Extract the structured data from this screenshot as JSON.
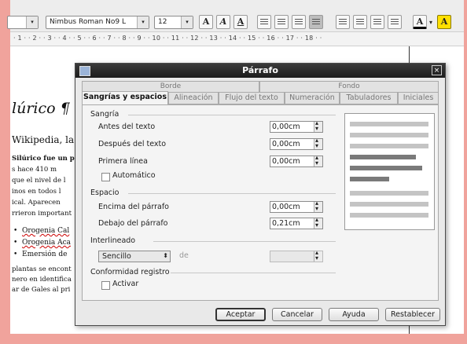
{
  "toolbar": {
    "font_name": "Nimbus Roman No9 L",
    "font_size": "12",
    "bold": "A",
    "italic": "A",
    "underline": "A",
    "font_color": "A",
    "highlight": "A"
  },
  "ruler": {
    "marks": "· 1 · · 2 · · 3 · · 4 · · 5 · · 6 · · 7 · · 8 · · 9 · · 10 · · 11 · · 12 · · 13 · · 14 · · 15 · · 16 · · 17 · · 18 · ·"
  },
  "document": {
    "heading": "lúrico ¶",
    "line1": "Wikipedia, la",
    "para_lines": [
      "Silúrico fue un pe",
      "s hace 410 m",
      "que el nivel de l",
      "inos en todos l",
      "ical. Aparecen",
      "rrieron important"
    ],
    "bullets": [
      "Orogenia Cal",
      "Orogenia Aca",
      "Emersión de"
    ],
    "tail_lines": [
      "plantas se encont",
      "nero en identifica",
      "ar de Gales al pri"
    ]
  },
  "dialog": {
    "title": "Párrafo",
    "close_glyph": "×",
    "tabs_row1": [
      "Borde",
      "Fondo"
    ],
    "tabs_row2": [
      "Sangrías y espacios",
      "Alineación",
      "Flujo del texto",
      "Numeración",
      "Tabuladores",
      "Iniciales"
    ],
    "sangria": {
      "title": "Sangría",
      "antes_label": "Antes del texto",
      "antes_value": "0,00cm",
      "despues_label": "Después del texto",
      "despues_value": "0,00cm",
      "primera_label": "Primera línea",
      "primera_value": "0,00cm",
      "auto_label": "Automático"
    },
    "espacio": {
      "title": "Espacio",
      "encima_label": "Encima del párrafo",
      "encima_value": "0,00cm",
      "debajo_label": "Debajo del párrafo",
      "debajo_value": "0,21cm"
    },
    "interlineado": {
      "title": "Interlineado",
      "select_value": "Sencillo",
      "de_label": "de",
      "de_value": ""
    },
    "conformidad": {
      "title": "Conformidad registro",
      "activar_label": "Activar"
    },
    "buttons": {
      "accept": "Aceptar",
      "cancel": "Cancelar",
      "help": "Ayuda",
      "reset": "Restablecer"
    }
  }
}
